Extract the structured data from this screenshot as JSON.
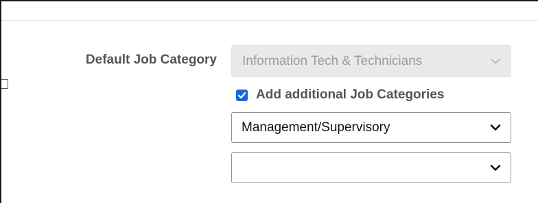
{
  "form": {
    "default_category": {
      "label": "Default Job Category",
      "value": "Information Tech & Technicians",
      "disabled": true
    },
    "additional": {
      "checkbox_label": "Add additional Job Categories",
      "checked": true
    },
    "additional_selects": [
      {
        "value": "Management/Supervisory"
      },
      {
        "value": ""
      }
    ]
  },
  "colors": {
    "label_text": "#555555",
    "checkbox_accent": "#1a66d8",
    "disabled_bg": "#e9e9ea",
    "divider": "#c9d3de"
  },
  "icons": {
    "disabled_chevron": "chevron-down-icon",
    "select_chevron": "chevron-down-icon",
    "checkbox_mark": "check-icon",
    "edge_glyph": "collapse-icon"
  }
}
